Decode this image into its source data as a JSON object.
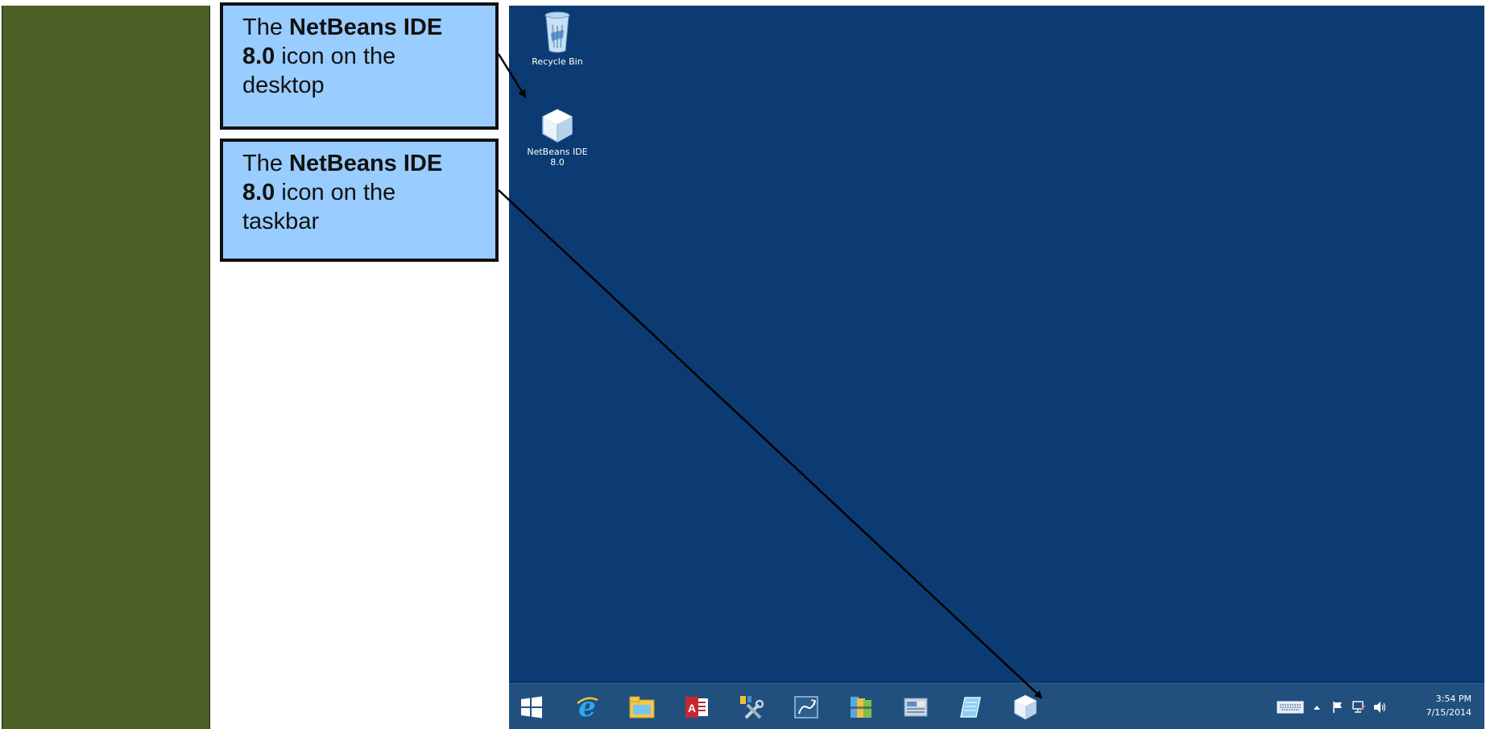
{
  "callouts": [
    {
      "pre": "The ",
      "bold1": "NetBeans IDE",
      "bold2": "8.0",
      "post1": " icon on the",
      "post2": "desktop"
    },
    {
      "pre": "The ",
      "bold1": "NetBeans IDE",
      "bold2": "8.0",
      "post1": " icon on the",
      "post2": "taskbar"
    }
  ],
  "desktop": {
    "background": "#0b3b72",
    "icons": [
      {
        "label": "Recycle Bin",
        "icon": "recycle-bin-icon"
      },
      {
        "label_line1": "NetBeans IDE",
        "label_line2": "8.0",
        "icon": "netbeans-icon"
      }
    ]
  },
  "taskbar": {
    "buttons": [
      {
        "icon": "windows-start-icon"
      },
      {
        "icon": "internet-explorer-icon"
      },
      {
        "icon": "file-explorer-icon"
      },
      {
        "icon": "access-icon"
      },
      {
        "icon": "tools-icon"
      },
      {
        "icon": "mysql-workbench-icon"
      },
      {
        "icon": "archive-icon"
      },
      {
        "icon": "control-panel-icon"
      },
      {
        "icon": "notepad-icon"
      },
      {
        "icon": "netbeans-icon"
      }
    ],
    "tray": {
      "icons": [
        "keyboard-icon",
        "show-hidden-icons-icon",
        "action-center-flag-icon",
        "network-icon",
        "volume-icon"
      ],
      "time": "3:54 PM",
      "date": "7/15/2014"
    }
  },
  "colors": {
    "side_panel": "#4c5f27",
    "callout_fill": "#99ccff",
    "taskbar": "#21507f"
  }
}
